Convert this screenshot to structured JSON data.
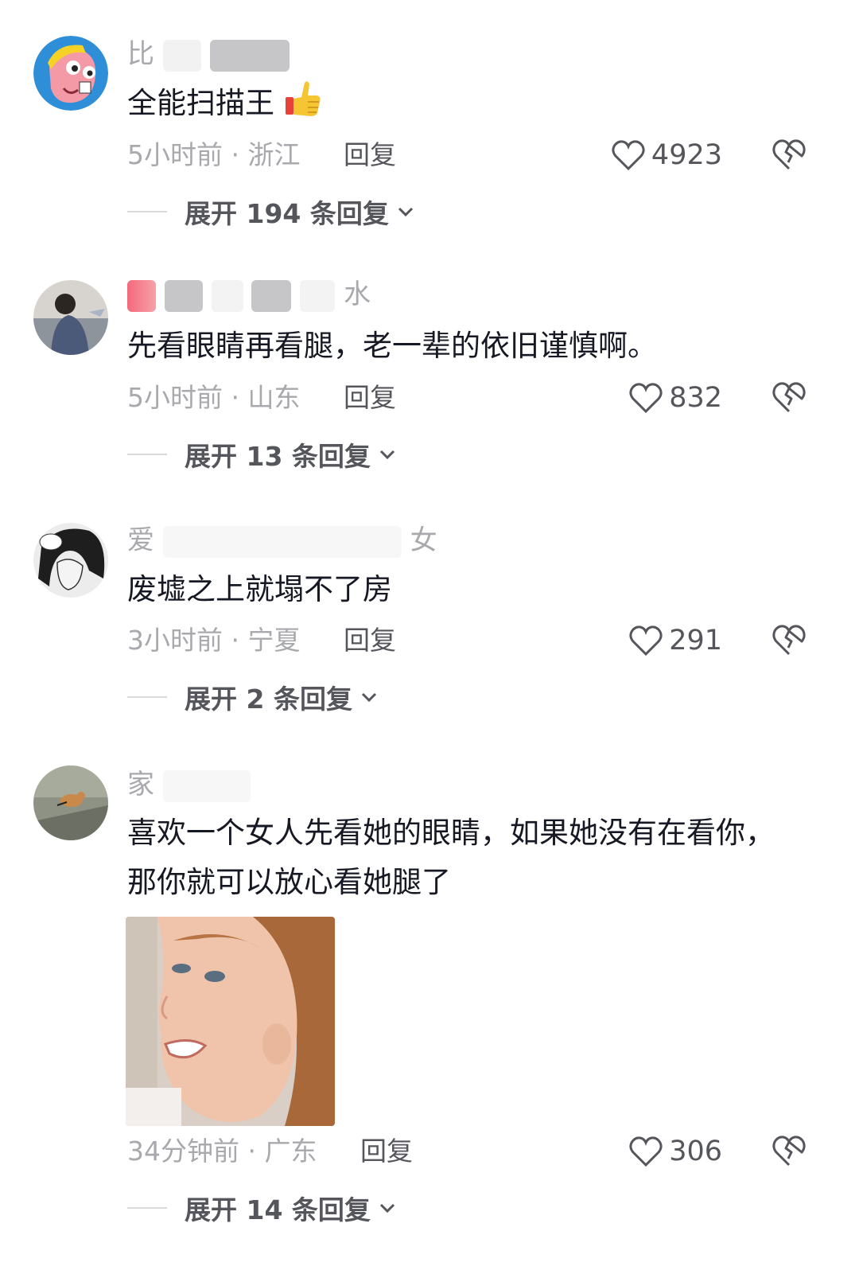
{
  "comments": [
    {
      "username_visible": "比",
      "text": "全能扫描王",
      "emoji": "thumbs-up-emoji",
      "time": "5小时前",
      "location": "浙江",
      "reply_label": "回复",
      "likes": "4923",
      "expand": "展开 194 条回复"
    },
    {
      "username_visible": "",
      "username_suffix": "水",
      "text": "先看眼睛再看腿，老一辈的依旧谨慎啊。",
      "time": "5小时前",
      "location": "山东",
      "reply_label": "回复",
      "likes": "832",
      "expand": "展开 13 条回复"
    },
    {
      "username_visible": "爱",
      "username_suffix": "女",
      "text": "废墟之上就塌不了房",
      "time": "3小时前",
      "location": "宁夏",
      "reply_label": "回复",
      "likes": "291",
      "expand": "展开 2 条回复"
    },
    {
      "username_visible": "家",
      "text_line1": "喜欢一个女人先看她的眼睛，如果她没有在看你，",
      "text_line2": "那你就可以放心看她腿了",
      "time": "34分钟前",
      "location": "广东",
      "reply_label": "回复",
      "likes": "306",
      "expand": "展开 14 条回复"
    }
  ],
  "separator": " · ",
  "colors": {
    "meta_gray": "#a8a9ad",
    "text_dark": "#161823",
    "action_gray": "#55565c"
  }
}
